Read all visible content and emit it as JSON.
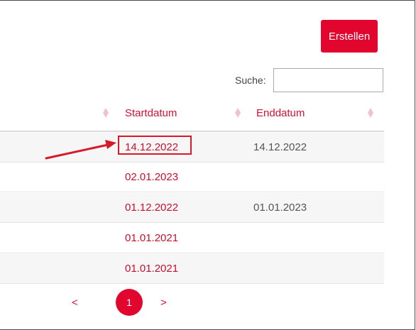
{
  "toolbar": {
    "create_label": "Erstellen"
  },
  "search": {
    "label": "Suche:",
    "value": ""
  },
  "table": {
    "columns": [
      "Startdatum",
      "Enddatum"
    ],
    "rows": [
      {
        "start": "14.12.2022",
        "end": "14.12.2022"
      },
      {
        "start": "02.01.2023",
        "end": ""
      },
      {
        "start": "01.12.2022",
        "end": "01.01.2023"
      },
      {
        "start": "01.01.2021",
        "end": ""
      },
      {
        "start": "01.01.2021",
        "end": ""
      }
    ]
  },
  "pagination": {
    "prev": "<",
    "current": "1",
    "next": ">"
  },
  "colors": {
    "accent": "#e2062e",
    "link": "#c8102e",
    "annotation": "#d71a2a"
  },
  "icons": {
    "sort": "sort-diamond-icon",
    "annotation": "red-arrow-icon"
  }
}
